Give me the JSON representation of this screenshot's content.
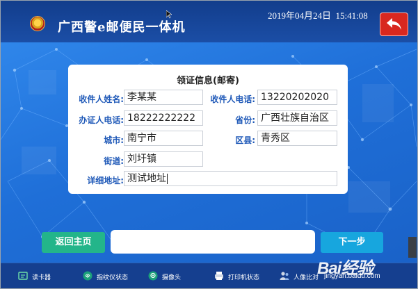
{
  "header": {
    "app_title": "广西警e邮便民一体机",
    "datetime": "2019年04月24日  15:41:08",
    "emblem_icon": "police-emblem-icon",
    "back_icon": "back-arrow-icon"
  },
  "form": {
    "title": "领证信息(邮寄)",
    "recipient_name_label": "收件人姓名:",
    "recipient_name": "李某某",
    "recipient_phone_label": "收件人电话:",
    "recipient_phone": "13220202020",
    "applicant_phone_label": "办证人电话:",
    "applicant_phone": "18222222222",
    "province_label": "省份:",
    "province": "广西壮族自治区",
    "city_label": "城市:",
    "city": "南宁市",
    "district_label": "区县:",
    "district": "青秀区",
    "street_label": "街道:",
    "street": "刘圩镇",
    "address_label": "详细地址:",
    "address": "测试地址"
  },
  "actions": {
    "home_label": "返回主页",
    "next_label": "下一步",
    "message": ""
  },
  "footer": {
    "items": [
      {
        "label": "读卡器",
        "icon": "card-reader-icon"
      },
      {
        "label": "指纹仪状态",
        "icon": "fingerprint-icon"
      },
      {
        "label": "摄像头",
        "icon": "camera-icon"
      },
      {
        "label": "打印机状态",
        "icon": "printer-icon"
      },
      {
        "label": "人像比对",
        "icon": "face-compare-icon"
      }
    ]
  },
  "watermark": {
    "logo": "Bai经验",
    "site": "jingyan.baidu.com"
  },
  "colors": {
    "header": "#123d8c",
    "background": "#1f6fd8",
    "label": "#1f59b8",
    "home_button": "#23b58a",
    "next_button": "#17a6de",
    "back_button": "#d8281f"
  }
}
